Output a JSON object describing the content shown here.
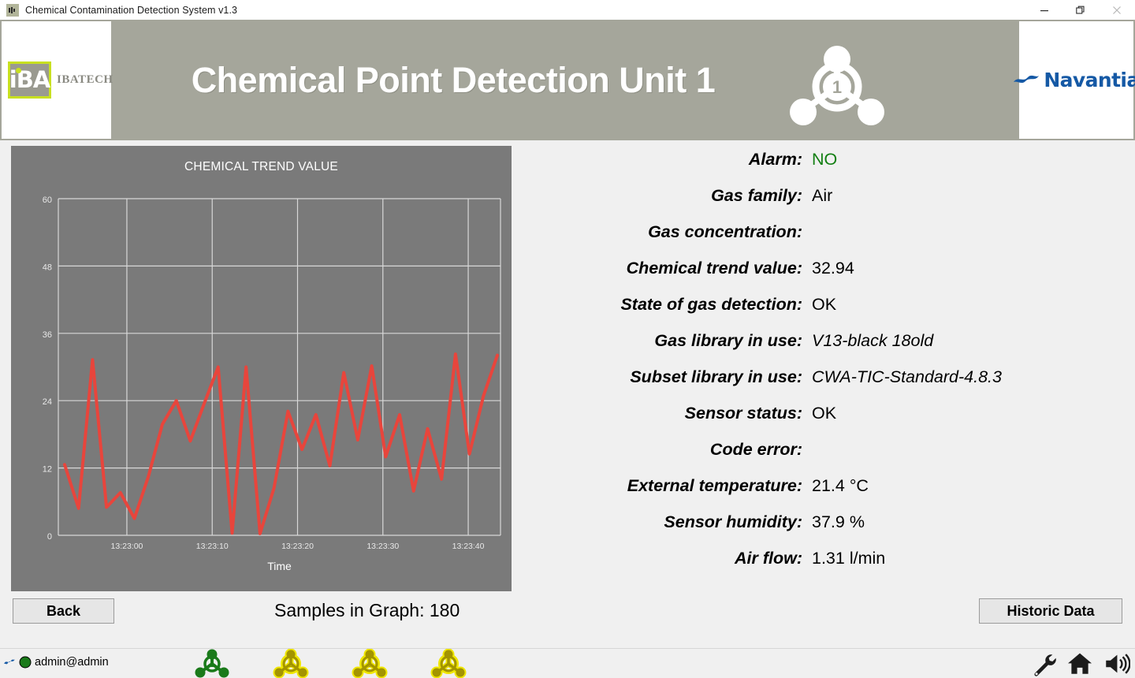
{
  "window": {
    "title": "Chemical Contamination Detection System v1.3",
    "app_icon": "app-icon",
    "controls": {
      "minimize": "minimize",
      "restore": "restore",
      "close": "close"
    }
  },
  "header": {
    "title": "Chemical Point Detection Unit 1",
    "left_logo": {
      "mark_text": "iBA",
      "word": "IBATECH"
    },
    "right_logo": {
      "word": "Navantia",
      "color": "#1559a5"
    },
    "unit_badge": "1"
  },
  "chart_data": {
    "type": "line",
    "title": "CHEMICAL TREND VALUE",
    "xlabel": "Time",
    "ylabel": "",
    "ylim": [
      0,
      60
    ],
    "yticks": [
      0,
      12,
      24,
      36,
      48,
      60
    ],
    "xticks": [
      "13:23:00",
      "13:23:10",
      "13:23:20",
      "13:23:30",
      "13:23:40"
    ],
    "grid": true,
    "series_color": "#e8453c",
    "background": "#7a7a7a",
    "grid_color": "#d8d8d8",
    "series": [
      {
        "name": "Chemical trend value",
        "values": [
          12.6,
          4.8,
          31.3,
          5.0,
          7.6,
          3.0,
          10.5,
          19.8,
          24.0,
          16.8,
          23.5,
          30.0,
          0.4,
          30.0,
          0.3,
          8.4,
          22.1,
          15.3,
          21.5,
          12.4,
          29.0,
          17.0,
          30.2,
          14.0,
          21.5,
          7.9,
          19.0,
          10.0,
          32.3,
          14.5,
          24.8,
          32.1
        ],
        "samples_note": "rendered as a dense 180-sample zig-zag trace"
      }
    ]
  },
  "readout": [
    {
      "label": "Alarm:",
      "value": "NO",
      "style": "green"
    },
    {
      "label": "Gas family:",
      "value": "Air",
      "style": "plain"
    },
    {
      "label": "Gas concentration:",
      "value": "",
      "style": "plain"
    },
    {
      "label": "Chemical trend value:",
      "value": "32.94",
      "style": "plain"
    },
    {
      "label": "State of gas detection:",
      "value": "OK",
      "style": "plain"
    },
    {
      "label": "Gas library in use:",
      "value": "V13-black 18old",
      "style": "italic"
    },
    {
      "label": "Subset library in use:",
      "value": "CWA-TIC-Standard-4.8.3",
      "style": "italic"
    },
    {
      "label": "Sensor status:",
      "value": "OK",
      "style": "plain"
    },
    {
      "label": "Code error:",
      "value": "",
      "style": "plain"
    },
    {
      "label": "External temperature:",
      "value": "21.4 °C",
      "style": "plain"
    },
    {
      "label": "Sensor humidity:",
      "value": "37.9 %",
      "style": "plain"
    },
    {
      "label": "Air flow:",
      "value": "1.31 l/min",
      "style": "plain"
    }
  ],
  "controls": {
    "back_label": "Back",
    "historic_label": "Historic Data",
    "samples_label": "Samples in Graph: 180"
  },
  "statusbar": {
    "user": "admin@admin",
    "user_status_color": "#1a7a1a",
    "units": [
      {
        "number": "1",
        "color": "#1a7a1a",
        "state": "ok"
      },
      {
        "number": "2",
        "color": "#efe600",
        "state": "warning"
      },
      {
        "number": "3",
        "color": "#efe600",
        "state": "warning"
      },
      {
        "number": "4",
        "color": "#efe600",
        "state": "warning"
      }
    ],
    "icons": [
      "wrench-icon",
      "home-icon",
      "speaker-icon"
    ]
  }
}
